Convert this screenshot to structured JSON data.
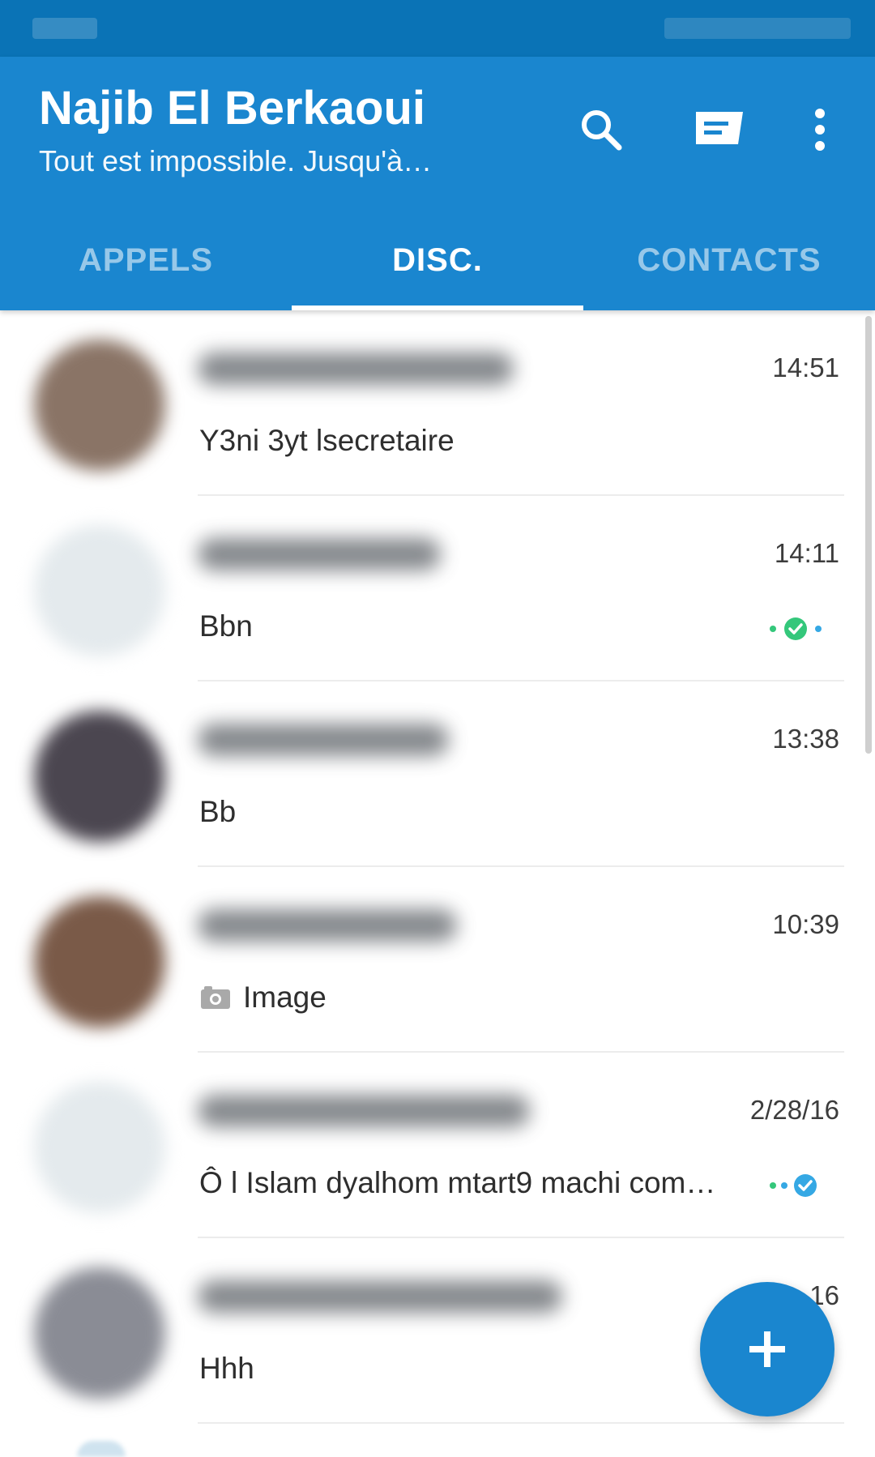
{
  "header": {
    "title": "Najib El Berkaoui",
    "subtitle": "Tout est impossible. Jusqu'à…",
    "accent_color": "#1a86cf",
    "icons": [
      "search-icon",
      "compose-icon",
      "more-vert-icon"
    ]
  },
  "tabs": [
    {
      "label": "APPELS",
      "active": false
    },
    {
      "label": "DISC.",
      "active": true
    },
    {
      "label": "CONTACTS",
      "active": false
    }
  ],
  "conversations": [
    {
      "time": "14:51",
      "preview": "Y3ni 3yt lsecretaire",
      "status": "none",
      "avatar_color": "#8a7466"
    },
    {
      "time": "14:11",
      "preview": "Bbn",
      "status": "delivered-green",
      "avatar_color": "#e4eaed"
    },
    {
      "time": "13:38",
      "preview": "Bb",
      "status": "none",
      "avatar_color": "#4b4650"
    },
    {
      "time": "10:39",
      "preview": "Image",
      "status": "none",
      "avatar_color": "#7a5a48",
      "preview_icon": "camera-icon"
    },
    {
      "time": "2/28/16",
      "preview": "Ô l Islam dyalhom mtart9 machi com…",
      "status": "read-blue",
      "avatar_color": "#e4eaed"
    },
    {
      "time": "…16",
      "preview": "Hhh",
      "status": "none",
      "avatar_color": "#8a8c95"
    }
  ],
  "fab": {
    "icon": "plus-icon",
    "label": "+"
  },
  "status_colors": {
    "green": "#34c77b",
    "blue": "#35a8e4"
  }
}
